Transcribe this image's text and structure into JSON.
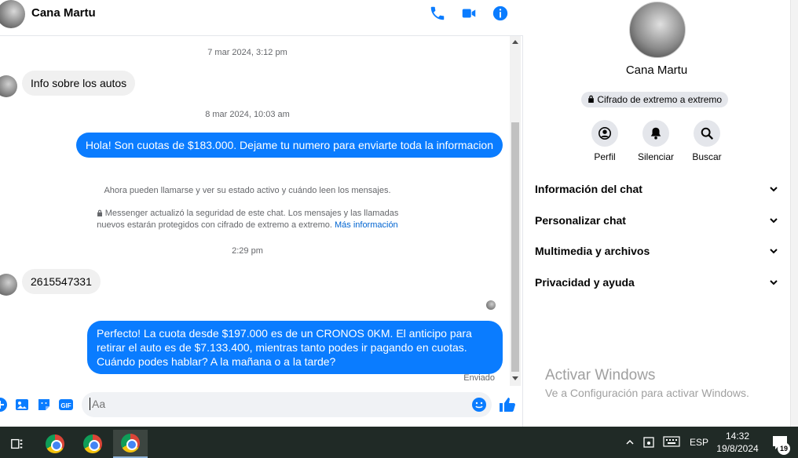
{
  "header": {
    "contact_name": "Cana Martu",
    "icons": [
      "phone-icon",
      "video-icon",
      "info-icon"
    ]
  },
  "messages": {
    "timestamp_1": "7 mar 2024, 3:12 pm",
    "incoming_1": "Info sobre los autos",
    "timestamp_2": "8 mar 2024, 10:03 am",
    "outgoing_1": "Hola! Son cuotas de $183.000. Dejame tu numero para enviarte toda la informacion",
    "system_1": "Ahora pueden llamarse y ver su estado activo y cuándo leen los mensajes.",
    "system_2_line1": "Messenger actualizó la seguridad de este chat. Los mensajes y las llamadas",
    "system_2_line2": "nuevos estarán protegidos con cifrado de extremo a extremo.",
    "system_2_link": "Más información",
    "timestamp_3": "2:29 pm",
    "incoming_2": "2615547331",
    "outgoing_2": "Perfecto! La cuota desde $197.000 es de un CRONOS 0KM. El anticipo para retirar el auto es de $7.133.400, mientras tanto podes ir pagando en cuotas. Cuándo podes hablar? A la mañana o a la tarde?",
    "status": "Enviado"
  },
  "composer": {
    "placeholder": "Aa",
    "icons": [
      "plus-icon",
      "image-icon",
      "sticker-icon",
      "gif-icon",
      "emoji-icon",
      "like-icon"
    ]
  },
  "info_panel": {
    "name": "Cana Martu",
    "e2e_label": "Cifrado de extremo a extremo",
    "actions": [
      {
        "label": "Perfil",
        "icon": "profile-icon"
      },
      {
        "label": "Silenciar",
        "icon": "bell-icon"
      },
      {
        "label": "Buscar",
        "icon": "search-icon"
      }
    ],
    "sections": [
      {
        "label": "Información del chat"
      },
      {
        "label": "Personalizar chat"
      },
      {
        "label": "Multimedia y archivos"
      },
      {
        "label": "Privacidad y ayuda"
      }
    ]
  },
  "watermark": {
    "title": "Activar Windows",
    "subtitle": "Ve a Configuración para activar Windows."
  },
  "taskbar": {
    "language": "ESP",
    "time": "14:32",
    "date": "19/8/2024",
    "notification_count": "19"
  },
  "colors": {
    "accent": "#0a7cff",
    "taskbar": "#202a26"
  }
}
